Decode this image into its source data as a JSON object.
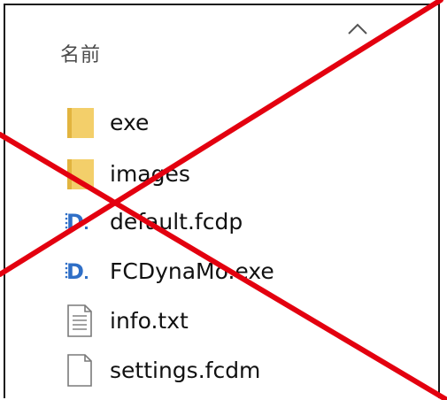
{
  "header": {
    "name_column": "名前"
  },
  "files": [
    {
      "name": "exe",
      "icon": "folder-icon"
    },
    {
      "name": "images",
      "icon": "folder-icon"
    },
    {
      "name": "default.fcdp",
      "icon": "fcd-file-icon"
    },
    {
      "name": "FCDynaMo.exe",
      "icon": "fcd-app-icon"
    },
    {
      "name": "info.txt",
      "icon": "text-file-icon"
    },
    {
      "name": "settings.fcdm",
      "icon": "blank-file-icon"
    }
  ],
  "colors": {
    "folder": "#f3cf6a",
    "folder_dark": "#e2b43f",
    "annotation_cross": "#e3000f",
    "fcd_blue": "#2f6fc7"
  }
}
